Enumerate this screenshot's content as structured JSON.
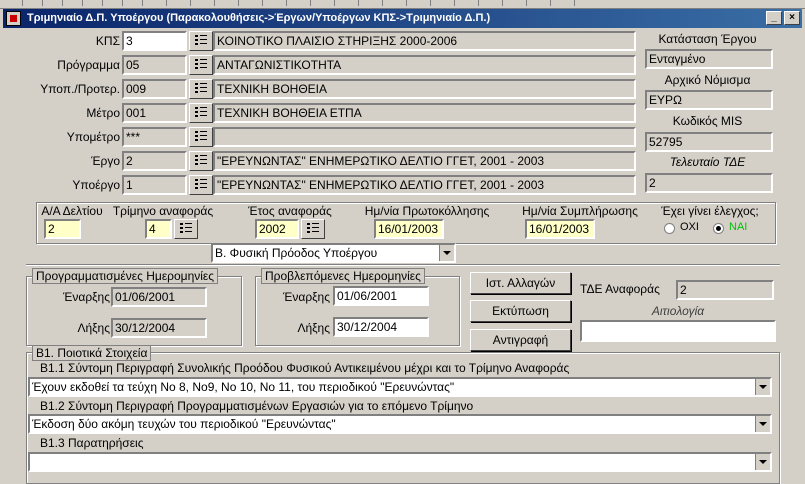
{
  "window": {
    "title": "Τριμηνιαίο Δ.Π. Υποέργου (Παρακολουθήσεις->Έργων/Υποέργων ΚΠΣ->Τριμηνιαίο Δ.Π.)",
    "close_glyph": "×",
    "minimize_glyph": "_"
  },
  "header": {
    "rows": [
      {
        "label": "ΚΠΣ",
        "code": "3",
        "desc": "ΚΟΙΝΟΤΙΚΟ ΠΛΑΙΣΙΟ ΣΤΗΡΙΞΗΣ 2000-2006"
      },
      {
        "label": "Πρόγραμμα",
        "code": "05",
        "desc": "ΑΝΤΑΓΩΝΙΣΤΙΚΟΤΗΤΑ"
      },
      {
        "label": "Υποπ./Προτερ.",
        "code": "009",
        "desc": "ΤΕΧΝΙΚΗ ΒΟΗΘΕΙΑ"
      },
      {
        "label": "Μέτρο",
        "code": "001",
        "desc": "ΤΕΧΝΙΚΗ ΒΟΗΘΕΙΑ ΕΤΠΑ"
      },
      {
        "label": "Υπομέτρο",
        "code": "***",
        "desc": ""
      },
      {
        "label": "Έργο",
        "code": "2",
        "desc": "\"ΕΡΕΥΝΩΝΤΑΣ\" ΕΝΗΜΕΡΩΤΙΚΟ ΔΕΛΤΙΟ ΓΓΕΤ, 2001 - 2003"
      },
      {
        "label": "Υποέργο",
        "code": "1",
        "desc": "\"ΕΡΕΥΝΩΝΤΑΣ\" ΕΝΗΜΕΡΩΤΙΚΟ ΔΕΛΤΙΟ ΓΓΕΤ, 2001 - 2003"
      }
    ]
  },
  "info": {
    "status_label": "Κατάσταση Έργου",
    "status_value": "Ενταγμένο",
    "currency_label": "Αρχικό Νόμισμα",
    "currency_value": "ΕΥΡΩ",
    "mis_label": "Κωδικός MIS",
    "mis_value": "52795",
    "last_tde_label": "Τελευταίο ΤΔΕ",
    "last_tde_value": "2"
  },
  "report": {
    "ad_label": "Α/Α Δελτίου",
    "ad_value": "2",
    "quarter_label": "Τρίμηνο αναφοράς",
    "quarter_value": "4",
    "year_label": "Έτος αναφοράς",
    "year_value": "2002",
    "protocol_label": "Ημ/νία Πρωτοκόλλησης",
    "protocol_value": "16/01/2003",
    "completion_label": "Ημ/νία Συμπλήρωσης",
    "completion_value": "16/01/2003",
    "checked_label": "Έχει γίνει έλεγχος;",
    "option_no": "ΟΧΙ",
    "option_yes": "ΝΑΙ",
    "selected": "yes"
  },
  "section_select": {
    "value": "Β. Φυσική Πρόοδος Υποέργου"
  },
  "planned": {
    "title": "Προγραμματισμένες Ημερομηνίες",
    "start_label": "Έναρξης",
    "start_value": "01/06/2001",
    "end_label": "Λήξης",
    "end_value": "30/12/2004"
  },
  "forecast": {
    "title": "Προβλεπόμενες Ημερομηνίες",
    "start_label": "Έναρξης",
    "start_value": "01/06/2001",
    "end_label": "Λήξης",
    "end_value": "30/12/2004"
  },
  "actions": {
    "history": "Ιστ. Αλλαγών",
    "print": "Εκτύπωση",
    "copy": "Αντιγραφή"
  },
  "tde": {
    "ref_label": "ΤΔΕ Αναφοράς",
    "ref_value": "2",
    "reason_label": "Αιτιολογία",
    "reason_value": ""
  },
  "qualitative": {
    "title": "Β1. Ποιοτικά Στοιχεία",
    "b11_label": "Β1.1 Σύντομη Περιγραφή Συνολικής Προόδου Φυσικού Αντικειμένου μέχρι και το Τρίμηνο Αναφοράς",
    "b11_value": "Έχουν εκδοθεί τα τεύχη Νο 8, Νο9, Νο 10, Νο 11, του περιοδικού \"Ερευνώντας\"",
    "b12_label": "Β1.2 Σύντομη Περιγραφή Προγραμματισμένων Εργασιών για το επόμενο Τρίμηνο",
    "b12_value": "Έκδοση δύο ακόμη τευχών του περιοδικού \"Ερευνώντας\"",
    "b13_label": "Β1.3 Παρατηρήσεις",
    "b13_value": ""
  }
}
